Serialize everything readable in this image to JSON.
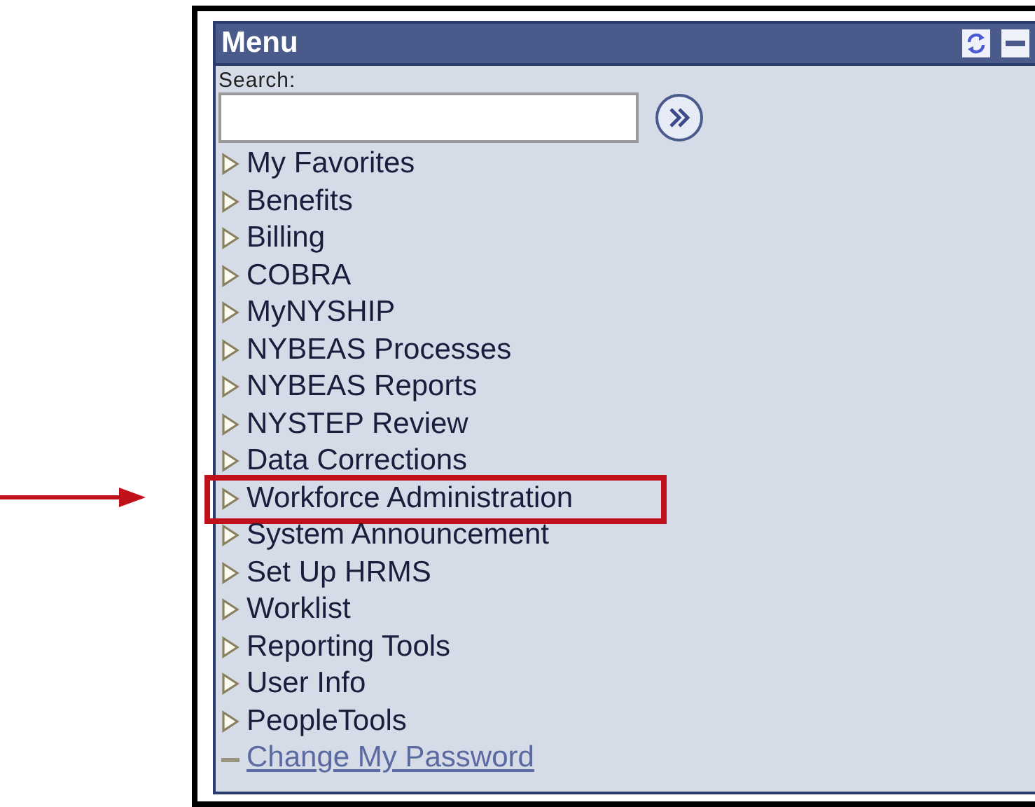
{
  "menu": {
    "title": "Menu",
    "search": {
      "label": "Search:"
    },
    "items": [
      {
        "kind": "folder",
        "label": "My Favorites",
        "highlighted": false
      },
      {
        "kind": "folder",
        "label": "Benefits",
        "highlighted": false
      },
      {
        "kind": "folder",
        "label": "Billing",
        "highlighted": false
      },
      {
        "kind": "folder",
        "label": "COBRA",
        "highlighted": false
      },
      {
        "kind": "folder",
        "label": "MyNYSHIP",
        "highlighted": false
      },
      {
        "kind": "folder",
        "label": "NYBEAS Processes",
        "highlighted": false
      },
      {
        "kind": "folder",
        "label": "NYBEAS Reports",
        "highlighted": false
      },
      {
        "kind": "folder",
        "label": "NYSTEP Review",
        "highlighted": false
      },
      {
        "kind": "folder",
        "label": "Data Corrections",
        "highlighted": false
      },
      {
        "kind": "folder",
        "label": "Workforce Administration",
        "highlighted": true
      },
      {
        "kind": "folder",
        "label": "System Announcement",
        "highlighted": false
      },
      {
        "kind": "folder",
        "label": "Set Up HRMS",
        "highlighted": false
      },
      {
        "kind": "folder",
        "label": "Worklist",
        "highlighted": false
      },
      {
        "kind": "folder",
        "label": "Reporting Tools",
        "highlighted": false
      },
      {
        "kind": "folder",
        "label": "User Info",
        "highlighted": false
      },
      {
        "kind": "folder",
        "label": "PeopleTools",
        "highlighted": false
      },
      {
        "kind": "link",
        "label": "Change My Password",
        "highlighted": false
      }
    ]
  }
}
